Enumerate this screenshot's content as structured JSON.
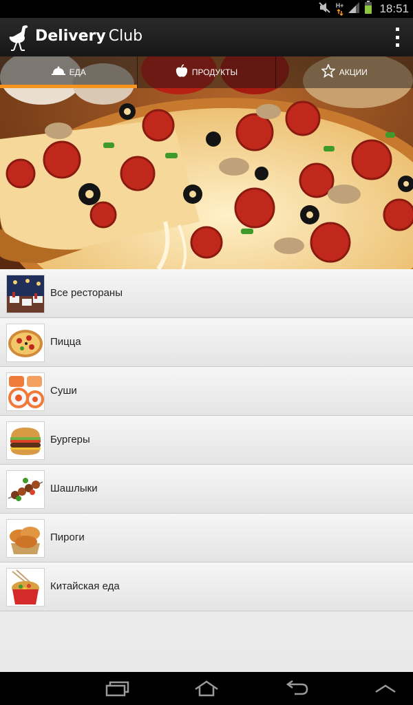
{
  "statusbar": {
    "time": "18:51",
    "network_label": "H+",
    "icons": [
      "mute-icon",
      "network-hplus-icon",
      "signal-icon",
      "battery-icon"
    ]
  },
  "actionbar": {
    "title_bold": "Delivery",
    "title_light": "Club",
    "logo_icon": "ostrich-logo-icon",
    "menu_icon": "overflow-menu-icon"
  },
  "tabs": [
    {
      "label": "ЕДА",
      "icon": "cloche-icon",
      "active": true
    },
    {
      "label": "ПРОДУКТЫ",
      "icon": "apple-icon",
      "active": false
    },
    {
      "label": "АКЦИИ",
      "icon": "star-icon",
      "active": false
    }
  ],
  "colors": {
    "accent": "#f7941d",
    "actionbar": "#1f1f1f",
    "list_bg": "#eeeeee",
    "text": "#222222"
  },
  "categories": [
    {
      "label": "Все рестораны",
      "thumb": "restaurant-thumbnail"
    },
    {
      "label": "Пицца",
      "thumb": "pizza-thumbnail"
    },
    {
      "label": "Суши",
      "thumb": "sushi-thumbnail"
    },
    {
      "label": "Бургеры",
      "thumb": "burger-thumbnail"
    },
    {
      "label": "Шашлыки",
      "thumb": "shashlik-thumbnail"
    },
    {
      "label": "Пироги",
      "thumb": "pies-thumbnail"
    },
    {
      "label": "Китайская еда",
      "thumb": "chinese-food-thumbnail"
    }
  ],
  "navbar": {
    "icons": [
      "recent-apps-icon",
      "home-icon",
      "back-icon",
      "expand-up-icon"
    ]
  }
}
